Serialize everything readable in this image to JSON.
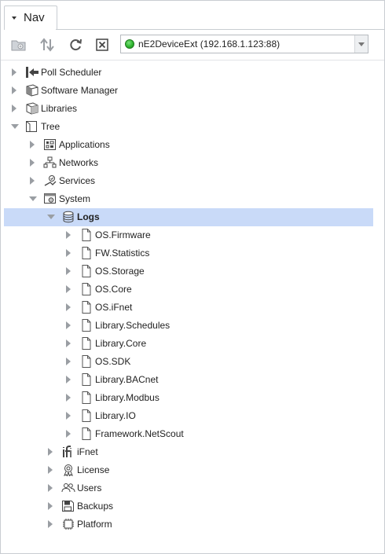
{
  "tab": {
    "title": "Nav"
  },
  "toolbar": {
    "buttons": [
      "new-folder-icon",
      "sync-icon",
      "refresh-icon",
      "close-icon"
    ],
    "device": {
      "name": "nE2DeviceExt (192.168.1.123:88)",
      "status_color": "#2fb52f"
    }
  },
  "colors": {
    "selection": "#c9daf8",
    "expander": "#9a9ea3",
    "border": "#c9cdd2"
  },
  "tree": [
    {
      "label": "Poll Scheduler",
      "icon": "poll-scheduler-icon",
      "level": 0,
      "state": "closed"
    },
    {
      "label": "Software Manager",
      "icon": "software-manager-icon",
      "level": 0,
      "state": "closed"
    },
    {
      "label": "Libraries",
      "icon": "libraries-icon",
      "level": 0,
      "state": "closed"
    },
    {
      "label": "Tree",
      "icon": "tree-icon",
      "level": 0,
      "state": "open"
    },
    {
      "label": "Applications",
      "icon": "applications-icon",
      "level": 1,
      "state": "closed"
    },
    {
      "label": "Networks",
      "icon": "networks-icon",
      "level": 1,
      "state": "closed"
    },
    {
      "label": "Services",
      "icon": "services-icon",
      "level": 1,
      "state": "closed"
    },
    {
      "label": "System",
      "icon": "system-icon",
      "level": 1,
      "state": "open"
    },
    {
      "label": "Logs",
      "icon": "database-icon",
      "level": 2,
      "state": "open",
      "selected": true
    },
    {
      "label": "OS.Firmware",
      "icon": "file-icon",
      "level": 3,
      "state": "closed"
    },
    {
      "label": "FW.Statistics",
      "icon": "file-icon",
      "level": 3,
      "state": "closed"
    },
    {
      "label": "OS.Storage",
      "icon": "file-icon",
      "level": 3,
      "state": "closed"
    },
    {
      "label": "OS.Core",
      "icon": "file-icon",
      "level": 3,
      "state": "closed"
    },
    {
      "label": "OS.iFnet",
      "icon": "file-icon",
      "level": 3,
      "state": "closed"
    },
    {
      "label": "Library.Schedules",
      "icon": "file-icon",
      "level": 3,
      "state": "closed"
    },
    {
      "label": "Library.Core",
      "icon": "file-icon",
      "level": 3,
      "state": "closed"
    },
    {
      "label": "OS.SDK",
      "icon": "file-icon",
      "level": 3,
      "state": "closed"
    },
    {
      "label": "Library.BACnet",
      "icon": "file-icon",
      "level": 3,
      "state": "closed"
    },
    {
      "label": "Library.Modbus",
      "icon": "file-icon",
      "level": 3,
      "state": "closed"
    },
    {
      "label": "Library.IO",
      "icon": "file-icon",
      "level": 3,
      "state": "closed"
    },
    {
      "label": "Framework.NetScout",
      "icon": "file-icon",
      "level": 3,
      "state": "closed"
    },
    {
      "label": "iFnet",
      "icon": "ifnet-icon",
      "level": 2,
      "state": "closed"
    },
    {
      "label": "License",
      "icon": "license-icon",
      "level": 2,
      "state": "closed"
    },
    {
      "label": "Users",
      "icon": "users-icon",
      "level": 2,
      "state": "closed"
    },
    {
      "label": "Backups",
      "icon": "backups-icon",
      "level": 2,
      "state": "closed"
    },
    {
      "label": "Platform",
      "icon": "platform-icon",
      "level": 2,
      "state": "closed"
    }
  ]
}
